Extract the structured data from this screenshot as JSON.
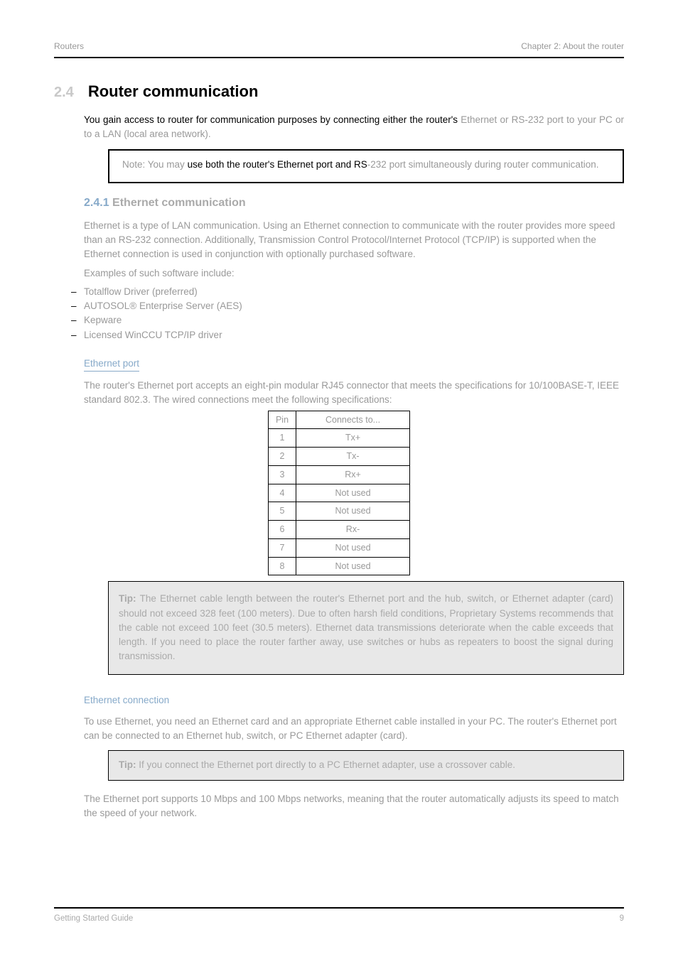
{
  "header": {
    "left": "Routers",
    "right": "Chapter 2:  About the router"
  },
  "section": {
    "number": "2.4",
    "title": "Router communication"
  },
  "intro": {
    "line1_visible": "You gain access to router for communication purposes by connecting either the router's ",
    "line1_faded": "Ethernet or RS-232 port to your PC or to a LAN (local area network)."
  },
  "note1": {
    "pre": "Note:  You may ",
    "visible": "use both the router's Ethernet port and RS",
    "post": "-232 port simultaneously during router communication."
  },
  "eth": {
    "subnum": "2.4.1",
    "subtitle": "Ethernet communication",
    "para": "Ethernet is a type of LAN communication. Using an Ethernet connection to communicate with the router provides more speed than an RS-232 connection. Additionally, Transmission Control Protocol/Internet Protocol (TCP/IP) is supported when the Ethernet connection is used in conjunction with optionally purchased software.",
    "bullets_intro": "Examples of such software include:",
    "bullets": [
      "Totalflow Driver (preferred)",
      "AUTOSOL® Enterprise Server (AES)",
      "Kepware",
      "Licensed WinCCU TCP/IP driver"
    ],
    "port_heading": "Ethernet port",
    "port_para": "The router's Ethernet port accepts an eight-pin modular RJ45 connector that meets the specifications for 10/100BASE-T, IEEE standard 802.3. The wired connections meet the following specifications:",
    "table": {
      "headers": [
        "Pin",
        "Connects to..."
      ],
      "rows": [
        [
          "1",
          "Tx+"
        ],
        [
          "2",
          "Tx-"
        ],
        [
          "3",
          "Rx+"
        ],
        [
          "4",
          "Not used"
        ],
        [
          "5",
          "Not used"
        ],
        [
          "6",
          "Rx-"
        ],
        [
          "7",
          "Not used"
        ],
        [
          "8",
          "Not used"
        ]
      ]
    },
    "connect_heading": "Ethernet connection",
    "connect_para": "To use Ethernet, you need an Ethernet card and an appropriate Ethernet cable installed in your PC. The router's Ethernet port can be connected to an Ethernet hub, switch, or PC Ethernet adapter (card).",
    "speed_para": "The Ethernet port supports 10 Mbps and 100 Mbps networks, meaning that the router automatically adjusts its speed to match the speed of your network."
  },
  "tip1": {
    "label": "Tip:  ",
    "body": "The Ethernet cable length between the router's Ethernet port and the hub, switch, or Ethernet adapter (card) should not exceed 328 feet (100 meters). Due to often harsh field conditions, Proprietary Systems recommends that the cable not exceed 100 feet (30.5 meters). Ethernet data transmissions deteriorate when the cable exceeds that length. If you need to place the router farther away, use switches or hubs as repeaters to boost the signal during transmission."
  },
  "tip2": {
    "label": "Tip:  ",
    "body": "If you connect the Ethernet port directly to a PC Ethernet adapter, use a crossover cable."
  },
  "footer": {
    "left": "Getting Started Guide",
    "right": "9"
  }
}
